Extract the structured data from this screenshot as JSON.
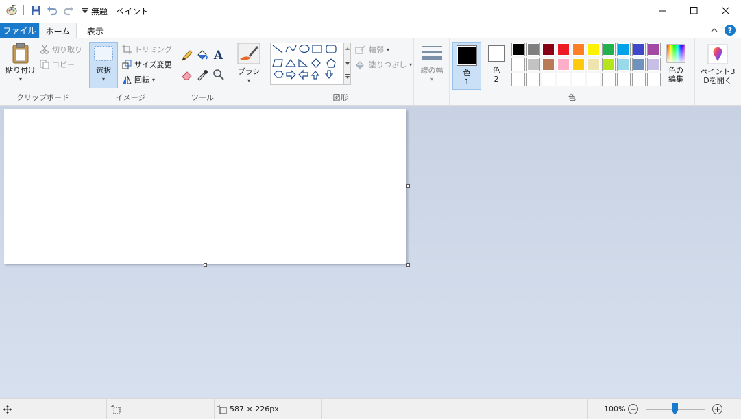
{
  "window": {
    "title": "無題 - ペイント"
  },
  "tabs": {
    "file": "ファイル",
    "home": "ホーム",
    "view": "表示"
  },
  "clipboard": {
    "paste": "貼り付け",
    "cut": "切り取り",
    "copy": "コピー",
    "label": "クリップボード"
  },
  "image": {
    "select": "選択",
    "crop": "トリミング",
    "resize": "サイズ変更",
    "rotate": "回転",
    "label": "イメージ"
  },
  "tools": {
    "label": "ツール"
  },
  "brushes": {
    "label": "ブラシ"
  },
  "shapes": {
    "outline": "輪郭",
    "fill": "塗りつぶし",
    "label": "図形"
  },
  "size": {
    "label": "線の幅"
  },
  "colors": {
    "color1_label": "色",
    "color1_num": "1",
    "color2_label": "色",
    "color2_num": "2",
    "edit_line1": "色の",
    "edit_line2": "編集",
    "label": "色",
    "color1": "#000000",
    "color2": "#ffffff",
    "palette_row1": [
      "#000000",
      "#7f7f7f",
      "#880015",
      "#ed1c24",
      "#ff7f27",
      "#fff200",
      "#22b14c",
      "#00a2e8",
      "#3f48cc",
      "#a349a4"
    ],
    "palette_row2": [
      "#ffffff",
      "#c3c3c3",
      "#b97a57",
      "#ffaec9",
      "#ffc90e",
      "#efe4b0",
      "#b5e61d",
      "#99d9ea",
      "#7092be",
      "#c8bfe7"
    ],
    "palette_row3": [
      "#ffffff",
      "#ffffff",
      "#ffffff",
      "#ffffff",
      "#ffffff",
      "#ffffff",
      "#ffffff",
      "#ffffff",
      "#ffffff",
      "#ffffff"
    ]
  },
  "paint3d": {
    "line1": "ペイント3",
    "line2": "Dを開く"
  },
  "status": {
    "image_size": "587 × 226px",
    "zoom": "100%"
  }
}
